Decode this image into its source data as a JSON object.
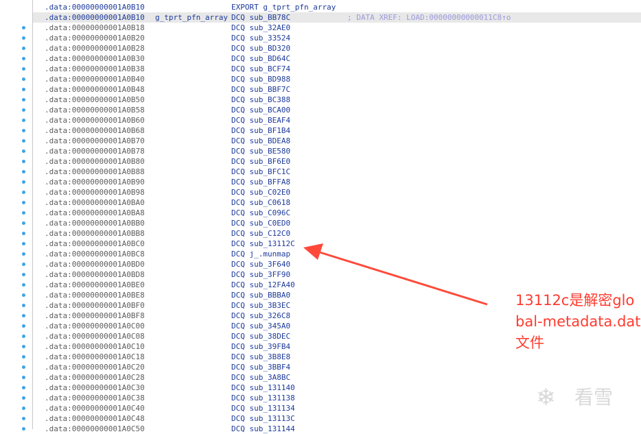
{
  "listing": {
    "rows": [
      {
        "addr": ".data:00000000001A0B10",
        "label": "",
        "instr": "EXPORT g_tprt_pfn_array",
        "comment": "",
        "dot": false,
        "selected": false,
        "hl": true
      },
      {
        "addr": ".data:00000000001A0B10",
        "label": "g_tprt_pfn_array",
        "instr": "DCQ sub_BB78C",
        "comment": "; DATA XREF: LOAD:00000000000011C8↑o",
        "dot": false,
        "selected": true,
        "hl": true
      },
      {
        "addr": ".data:00000000001A0B18",
        "label": "",
        "instr": "DCQ sub_32AE0",
        "comment": "",
        "dot": true,
        "selected": false,
        "hl": false
      },
      {
        "addr": ".data:00000000001A0B20",
        "label": "",
        "instr": "DCQ sub_33524",
        "comment": "",
        "dot": true,
        "selected": false,
        "hl": false
      },
      {
        "addr": ".data:00000000001A0B28",
        "label": "",
        "instr": "DCQ sub_BD320",
        "comment": "",
        "dot": true,
        "selected": false,
        "hl": false
      },
      {
        "addr": ".data:00000000001A0B30",
        "label": "",
        "instr": "DCQ sub_BD64C",
        "comment": "",
        "dot": true,
        "selected": false,
        "hl": false
      },
      {
        "addr": ".data:00000000001A0B38",
        "label": "",
        "instr": "DCQ sub_BCF74",
        "comment": "",
        "dot": true,
        "selected": false,
        "hl": false
      },
      {
        "addr": ".data:00000000001A0B40",
        "label": "",
        "instr": "DCQ sub_BD988",
        "comment": "",
        "dot": true,
        "selected": false,
        "hl": false
      },
      {
        "addr": ".data:00000000001A0B48",
        "label": "",
        "instr": "DCQ sub_BBF7C",
        "comment": "",
        "dot": true,
        "selected": false,
        "hl": false
      },
      {
        "addr": ".data:00000000001A0B50",
        "label": "",
        "instr": "DCQ sub_BC388",
        "comment": "",
        "dot": true,
        "selected": false,
        "hl": false
      },
      {
        "addr": ".data:00000000001A0B58",
        "label": "",
        "instr": "DCQ sub_BCA00",
        "comment": "",
        "dot": true,
        "selected": false,
        "hl": false
      },
      {
        "addr": ".data:00000000001A0B60",
        "label": "",
        "instr": "DCQ sub_BEAF4",
        "comment": "",
        "dot": true,
        "selected": false,
        "hl": false
      },
      {
        "addr": ".data:00000000001A0B68",
        "label": "",
        "instr": "DCQ sub_BF1B4",
        "comment": "",
        "dot": true,
        "selected": false,
        "hl": false
      },
      {
        "addr": ".data:00000000001A0B70",
        "label": "",
        "instr": "DCQ sub_BDEA8",
        "comment": "",
        "dot": true,
        "selected": false,
        "hl": false
      },
      {
        "addr": ".data:00000000001A0B78",
        "label": "",
        "instr": "DCQ sub_BE580",
        "comment": "",
        "dot": true,
        "selected": false,
        "hl": false
      },
      {
        "addr": ".data:00000000001A0B80",
        "label": "",
        "instr": "DCQ sub_BF6E0",
        "comment": "",
        "dot": true,
        "selected": false,
        "hl": false
      },
      {
        "addr": ".data:00000000001A0B88",
        "label": "",
        "instr": "DCQ sub_BFC1C",
        "comment": "",
        "dot": true,
        "selected": false,
        "hl": false
      },
      {
        "addr": ".data:00000000001A0B90",
        "label": "",
        "instr": "DCQ sub_BFFA8",
        "comment": "",
        "dot": true,
        "selected": false,
        "hl": false
      },
      {
        "addr": ".data:00000000001A0B98",
        "label": "",
        "instr": "DCQ sub_C02E0",
        "comment": "",
        "dot": true,
        "selected": false,
        "hl": false
      },
      {
        "addr": ".data:00000000001A0BA0",
        "label": "",
        "instr": "DCQ sub_C0618",
        "comment": "",
        "dot": true,
        "selected": false,
        "hl": false
      },
      {
        "addr": ".data:00000000001A0BA8",
        "label": "",
        "instr": "DCQ sub_C096C",
        "comment": "",
        "dot": true,
        "selected": false,
        "hl": false
      },
      {
        "addr": ".data:00000000001A0BB0",
        "label": "",
        "instr": "DCQ sub_C0ED0",
        "comment": "",
        "dot": true,
        "selected": false,
        "hl": false
      },
      {
        "addr": ".data:00000000001A0BB8",
        "label": "",
        "instr": "DCQ sub_C12C0",
        "comment": "",
        "dot": true,
        "selected": false,
        "hl": false
      },
      {
        "addr": ".data:00000000001A0BC0",
        "label": "",
        "instr": "DCQ sub_13112C",
        "comment": "",
        "dot": true,
        "selected": false,
        "hl": false
      },
      {
        "addr": ".data:00000000001A0BC8",
        "label": "",
        "instr": "DCQ j_.munmap",
        "comment": "",
        "dot": true,
        "selected": false,
        "hl": false
      },
      {
        "addr": ".data:00000000001A0BD0",
        "label": "",
        "instr": "DCQ sub_3F640",
        "comment": "",
        "dot": true,
        "selected": false,
        "hl": false
      },
      {
        "addr": ".data:00000000001A0BD8",
        "label": "",
        "instr": "DCQ sub_3FF90",
        "comment": "",
        "dot": true,
        "selected": false,
        "hl": false
      },
      {
        "addr": ".data:00000000001A0BE0",
        "label": "",
        "instr": "DCQ sub_12FA40",
        "comment": "",
        "dot": true,
        "selected": false,
        "hl": false
      },
      {
        "addr": ".data:00000000001A0BE8",
        "label": "",
        "instr": "DCQ sub_BBBA0",
        "comment": "",
        "dot": true,
        "selected": false,
        "hl": false
      },
      {
        "addr": ".data:00000000001A0BF0",
        "label": "",
        "instr": "DCQ sub_3B3EC",
        "comment": "",
        "dot": true,
        "selected": false,
        "hl": false
      },
      {
        "addr": ".data:00000000001A0BF8",
        "label": "",
        "instr": "DCQ sub_326C8",
        "comment": "",
        "dot": true,
        "selected": false,
        "hl": false
      },
      {
        "addr": ".data:00000000001A0C00",
        "label": "",
        "instr": "DCQ sub_345A0",
        "comment": "",
        "dot": true,
        "selected": false,
        "hl": false
      },
      {
        "addr": ".data:00000000001A0C08",
        "label": "",
        "instr": "DCQ sub_38DEC",
        "comment": "",
        "dot": true,
        "selected": false,
        "hl": false
      },
      {
        "addr": ".data:00000000001A0C10",
        "label": "",
        "instr": "DCQ sub_39FB4",
        "comment": "",
        "dot": true,
        "selected": false,
        "hl": false
      },
      {
        "addr": ".data:00000000001A0C18",
        "label": "",
        "instr": "DCQ sub_3B8E8",
        "comment": "",
        "dot": true,
        "selected": false,
        "hl": false
      },
      {
        "addr": ".data:00000000001A0C20",
        "label": "",
        "instr": "DCQ sub_3BBF4",
        "comment": "",
        "dot": true,
        "selected": false,
        "hl": false
      },
      {
        "addr": ".data:00000000001A0C28",
        "label": "",
        "instr": "DCQ sub_3A8BC",
        "comment": "",
        "dot": true,
        "selected": false,
        "hl": false
      },
      {
        "addr": ".data:00000000001A0C30",
        "label": "",
        "instr": "DCQ sub_131140",
        "comment": "",
        "dot": true,
        "selected": false,
        "hl": false
      },
      {
        "addr": ".data:00000000001A0C38",
        "label": "",
        "instr": "DCQ sub_131138",
        "comment": "",
        "dot": true,
        "selected": false,
        "hl": false
      },
      {
        "addr": ".data:00000000001A0C40",
        "label": "",
        "instr": "DCQ sub_131134",
        "comment": "",
        "dot": true,
        "selected": false,
        "hl": false
      },
      {
        "addr": ".data:00000000001A0C48",
        "label": "",
        "instr": "DCQ sub_13113C",
        "comment": "",
        "dot": true,
        "selected": false,
        "hl": false
      },
      {
        "addr": ".data:00000000001A0C50",
        "label": "",
        "instr": "DCQ sub_131144",
        "comment": "",
        "dot": true,
        "selected": false,
        "hl": false
      }
    ]
  },
  "annotation": {
    "text": "13112c是解密global-metadata.dat文件",
    "color": "#ff3b2f"
  },
  "watermark": {
    "text": "看雪",
    "icon": "snowflake-icon"
  }
}
